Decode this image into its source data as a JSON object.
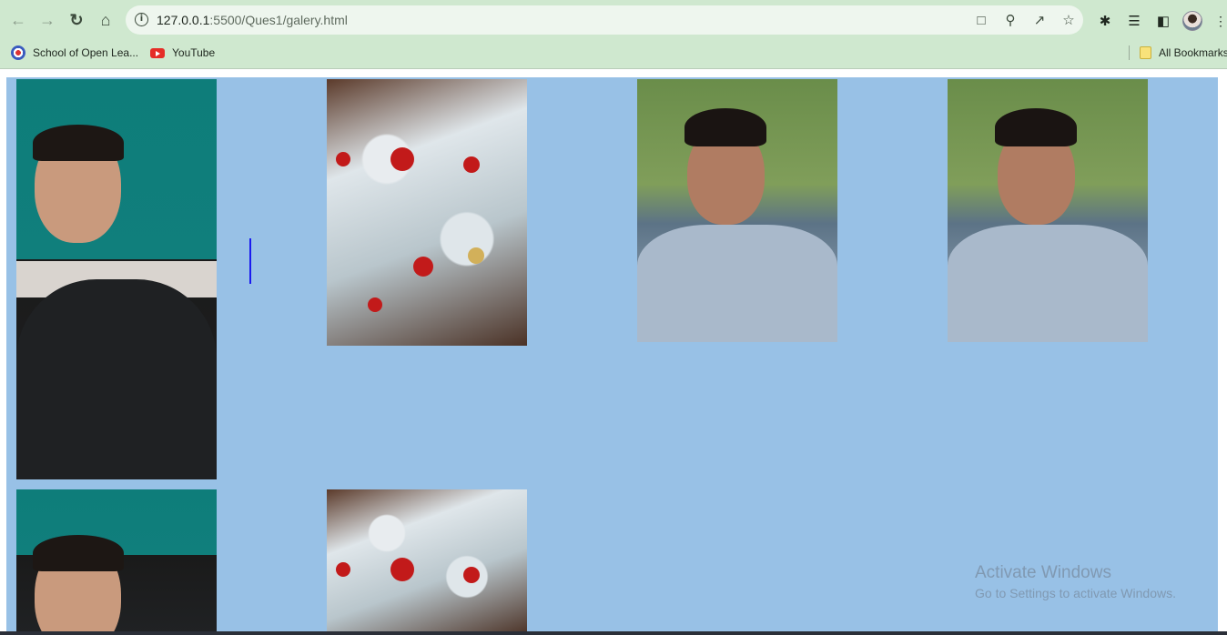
{
  "browser": {
    "url_host": "127.0.0.1",
    "url_path": ":5500/Ques1/galery.html",
    "bookmarks": [
      {
        "label": "School of Open Lea...",
        "icon": "school-favicon"
      },
      {
        "label": "YouTube",
        "icon": "youtube-favicon"
      }
    ],
    "all_bookmarks_label": "All Bookmarks"
  },
  "gallery": {
    "background": "#98c1e6",
    "photos": [
      {
        "subject": "portrait-teal-background"
      },
      {
        "subject": "christmas-tree"
      },
      {
        "subject": "portrait-leaves"
      },
      {
        "subject": "portrait-leaves"
      },
      {
        "subject": "portrait-teal-background"
      },
      {
        "subject": "christmas-tree"
      }
    ]
  },
  "watermark": {
    "title": "Activate Windows",
    "subtitle": "Go to Settings to activate Windows."
  }
}
